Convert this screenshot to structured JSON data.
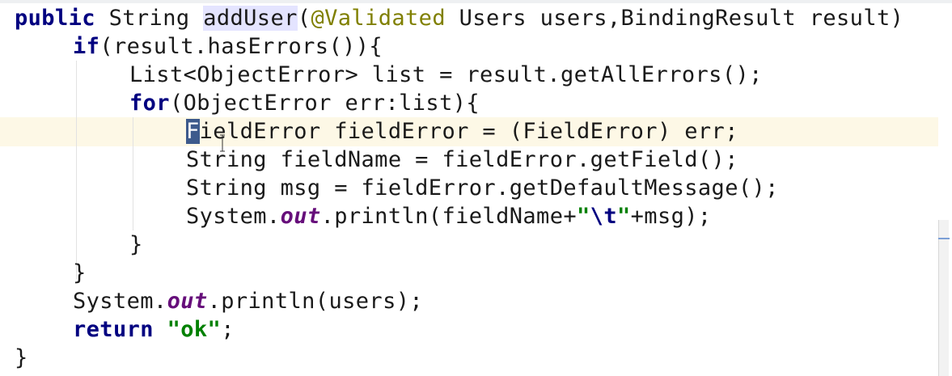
{
  "editor": {
    "language": "java",
    "lines": [
      {
        "id": "method-signature",
        "tokens": [
          {
            "t": "public",
            "c": "kw"
          },
          {
            "t": " String ",
            "c": ""
          },
          {
            "t": "addUser",
            "c": "mhl"
          },
          {
            "t": "(",
            "c": ""
          },
          {
            "t": "@Validated",
            "c": "ann"
          },
          {
            "t": " Users users,BindingResult result)",
            "c": ""
          }
        ]
      },
      {
        "id": "if-statement",
        "tokens": [
          {
            "t": "if",
            "c": "kw"
          },
          {
            "t": "(result.hasErrors()){",
            "c": ""
          }
        ]
      },
      {
        "id": "list-declaration",
        "tokens": [
          {
            "t": "List<ObjectError> list = result.getAllErrors();",
            "c": ""
          }
        ]
      },
      {
        "id": "for-loop",
        "tokens": [
          {
            "t": "for",
            "c": "kw"
          },
          {
            "t": "(ObjectError err:list){",
            "c": ""
          }
        ]
      },
      {
        "id": "field-error-cast",
        "tokens": [
          {
            "t": "F",
            "c": "caret-sel"
          },
          {
            "t": "ieldError fieldError = (FieldError) err;",
            "c": ""
          }
        ]
      },
      {
        "id": "field-name",
        "tokens": [
          {
            "t": "String fieldName = fieldError.getField();",
            "c": ""
          }
        ]
      },
      {
        "id": "field-msg",
        "tokens": [
          {
            "t": "String msg = fieldError.getDefaultMessage();",
            "c": ""
          }
        ]
      },
      {
        "id": "println-field",
        "tokens": [
          {
            "t": "System.",
            "c": ""
          },
          {
            "t": "out",
            "c": "fld"
          },
          {
            "t": ".println(fieldName+",
            "c": ""
          },
          {
            "t": "\"",
            "c": "str"
          },
          {
            "t": "\\t",
            "c": "esc"
          },
          {
            "t": "\"",
            "c": "str"
          },
          {
            "t": "+msg);",
            "c": ""
          }
        ]
      },
      {
        "id": "for-close",
        "tokens": [
          {
            "t": "}",
            "c": ""
          }
        ]
      },
      {
        "id": "if-close",
        "tokens": [
          {
            "t": "}",
            "c": ""
          }
        ]
      },
      {
        "id": "println-users",
        "tokens": [
          {
            "t": "System.",
            "c": ""
          },
          {
            "t": "out",
            "c": "fld"
          },
          {
            "t": ".println(users);",
            "c": ""
          }
        ]
      },
      {
        "id": "return-ok",
        "tokens": [
          {
            "t": "return",
            "c": "kw"
          },
          {
            "t": " ",
            "c": ""
          },
          {
            "t": "\"ok\"",
            "c": "str"
          },
          {
            "t": ";",
            "c": ""
          }
        ]
      },
      {
        "id": "method-close",
        "tokens": [
          {
            "t": "}",
            "c": ""
          }
        ]
      }
    ]
  },
  "colors": {
    "keyword": "#000080",
    "annotation": "#808000",
    "static_field": "#660e7a",
    "string": "#008000",
    "current_line": "#fdf8e6",
    "usage_highlight": "#e4e4ff"
  }
}
